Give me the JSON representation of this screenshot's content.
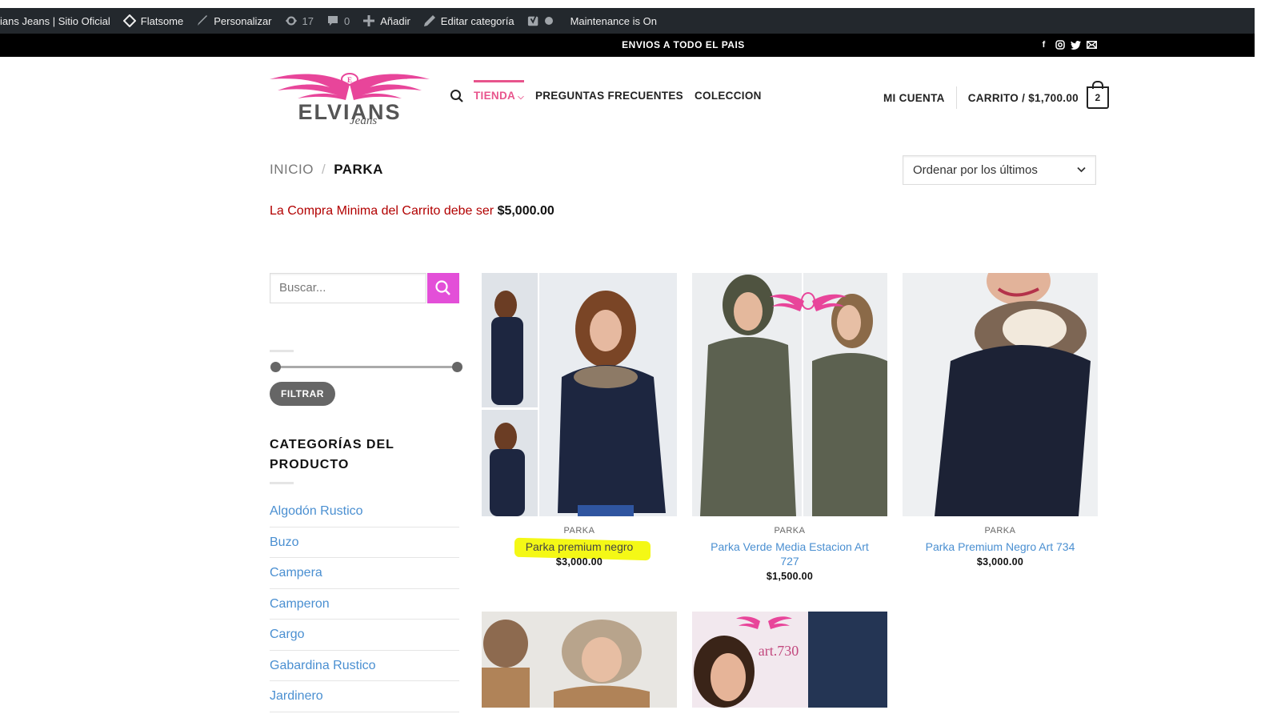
{
  "admin_bar": {
    "site_name": "ians Jeans | Sitio Oficial",
    "theme": "Flatsome",
    "customize": "Personalizar",
    "updates_count": "17",
    "comments_count": "0",
    "add_new": "Añadir",
    "edit_category": "Editar categoría",
    "maintenance": "Maintenance is On"
  },
  "top_bar": {
    "message": "ENVIOS A TODO EL PAIS",
    "social_icons": [
      "facebook-icon",
      "instagram-icon",
      "twitter-icon",
      "email-icon"
    ]
  },
  "header": {
    "logo_text": "ELVIANS",
    "logo_subtext": "Jeans",
    "nav": [
      "TIENDA",
      "PREGUNTAS FRECUENTES",
      "COLECCION"
    ],
    "account": "MI CUENTA",
    "cart_label": "CARRITO / $1,700.00",
    "cart_count": "2"
  },
  "breadcrumb": {
    "home": "INICIO",
    "separator": "/",
    "current": "PARKA"
  },
  "orderby": {
    "selected": "Ordenar por los últimos"
  },
  "notice": {
    "text": "La Compra Minima del Carrito debe ser ",
    "amount": "$5,000.00"
  },
  "sidebar": {
    "search_placeholder": "Buscar...",
    "filter_button": "FILTRAR",
    "categories_title": "CATEGORÍAS DEL PRODUCTO",
    "categories": [
      "Algodón Rustico",
      "Buzo",
      "Campera",
      "Camperon",
      "Cargo",
      "Gabardina Rustico",
      "Jardinero"
    ]
  },
  "products": [
    {
      "category": "PARKA",
      "name": "Parka premium negro",
      "price": "$3,000.00",
      "highlighted": true
    },
    {
      "category": "PARKA",
      "name": "Parka Verde Media Estacion Art 727",
      "price": "$1,500.00"
    },
    {
      "category": "PARKA",
      "name": "Parka Premium Negro Art 734",
      "price": "$3,000.00"
    }
  ],
  "product_images": {
    "p5_label": "art.730"
  },
  "colors": {
    "accent": "#e8548c",
    "link": "#4a8fd1",
    "notice": "#b20000",
    "search_button": "#e34fd8",
    "highlight": "#f4f816"
  }
}
